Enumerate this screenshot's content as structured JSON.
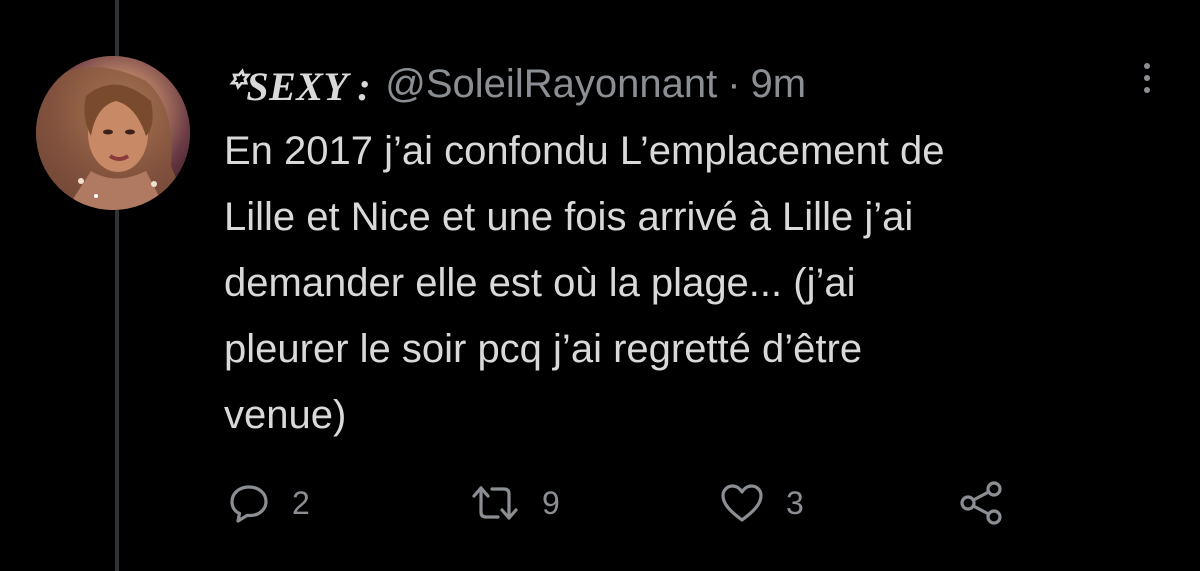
{
  "tweet": {
    "display_name": "꙳SEXY :",
    "handle": "@SoleilRayonnant",
    "separator": "·",
    "time": "9m",
    "text": "En 2017 j’ai confondu L’emplacement de\nLille et Nice et une fois arrivé à Lille j’ai\ndemander elle est où la plage... (j’ai\npleurer le soir pcq j’ai regretté d’être\nvenue)"
  },
  "actions": {
    "reply_count": "2",
    "retweet_count": "9",
    "like_count": "3"
  },
  "icons": {
    "reply": "reply-icon",
    "retweet": "retweet-icon",
    "like": "heart-icon",
    "share": "share-icon",
    "more": "more-icon"
  },
  "colors": {
    "background": "#000000",
    "text": "#d9d9d9",
    "secondary": "#8b8f93",
    "thread_line": "#2f3336"
  }
}
